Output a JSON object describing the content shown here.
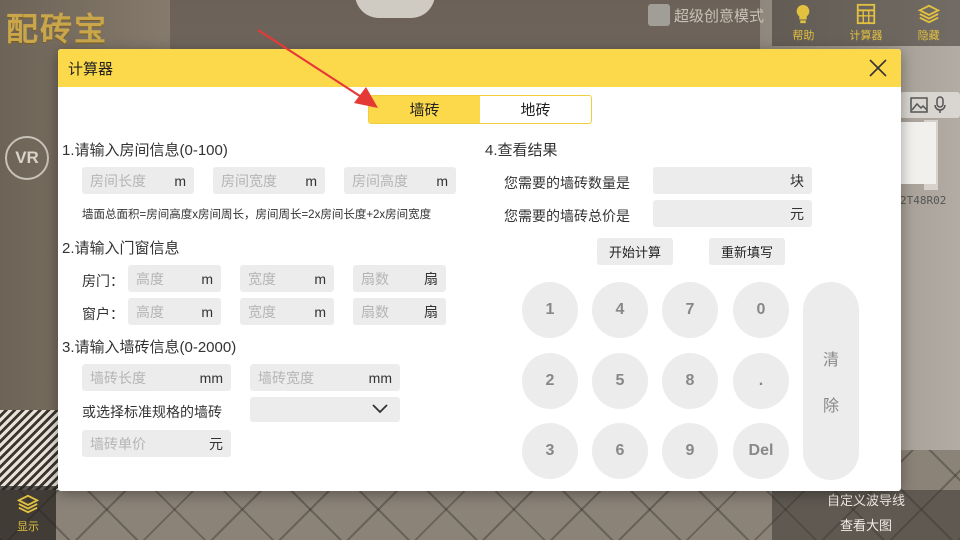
{
  "app": {
    "logo": "配砖宝",
    "creative_mode_label": "超级创意模式",
    "toolbar": [
      {
        "label": "帮助",
        "icon": "lightbulb-icon"
      },
      {
        "label": "计算器",
        "icon": "calculator-icon"
      },
      {
        "label": "隐藏",
        "icon": "layers-icon"
      }
    ],
    "vr_label": "VR",
    "show_label": "显示",
    "right_panel_code": "2T48R02",
    "bottom_links": [
      "自定义波导线",
      "查看大图"
    ]
  },
  "modal": {
    "title": "计算器",
    "tabs": [
      {
        "label": "墙砖",
        "active": true
      },
      {
        "label": "地砖",
        "active": false
      }
    ],
    "section1": {
      "title": "1.请输入房间信息(0-100)",
      "fields": [
        {
          "placeholder": "房间长度",
          "unit": "m"
        },
        {
          "placeholder": "房间宽度",
          "unit": "m"
        },
        {
          "placeholder": "房间高度",
          "unit": "m"
        }
      ],
      "formula": "墙面总面积=房间高度x房间周长，房间周长=2x房间长度+2x房间宽度"
    },
    "section2": {
      "title": "2.请输入门窗信息",
      "rows": [
        {
          "label": "房门：",
          "fields": [
            {
              "placeholder": "高度",
              "unit": "m"
            },
            {
              "placeholder": "宽度",
              "unit": "m"
            },
            {
              "placeholder": "扇数",
              "unit": "扇"
            }
          ]
        },
        {
          "label": "窗户：",
          "fields": [
            {
              "placeholder": "高度",
              "unit": "m"
            },
            {
              "placeholder": "宽度",
              "unit": "m"
            },
            {
              "placeholder": "扇数",
              "unit": "扇"
            }
          ]
        }
      ]
    },
    "section3": {
      "title": "3.请输入墙砖信息(0-2000)",
      "fields": [
        {
          "placeholder": "墙砖长度",
          "unit": "mm"
        },
        {
          "placeholder": "墙砖宽度",
          "unit": "mm"
        }
      ],
      "standard_label": "或选择标准规格的墙砖",
      "select_value": "",
      "price_field": {
        "placeholder": "墙砖单价",
        "unit": "元"
      }
    },
    "section4": {
      "title": "4.查看结果",
      "results": [
        {
          "label": "您需要的墙砖数量是",
          "unit": "块"
        },
        {
          "label": "您需要的墙砖总价是",
          "unit": "元"
        }
      ],
      "buttons": {
        "calculate": "开始计算",
        "reset": "重新填写"
      }
    },
    "keypad": {
      "keys": [
        [
          "1",
          "4",
          "7",
          "0"
        ],
        [
          "2",
          "5",
          "8",
          "."
        ],
        [
          "3",
          "6",
          "9",
          "Del"
        ]
      ],
      "clear": [
        "清",
        "除"
      ]
    }
  },
  "colors": {
    "accent_yellow": "#fcd94a",
    "field_gray": "#ececec",
    "annotation_red": "#e53935"
  }
}
